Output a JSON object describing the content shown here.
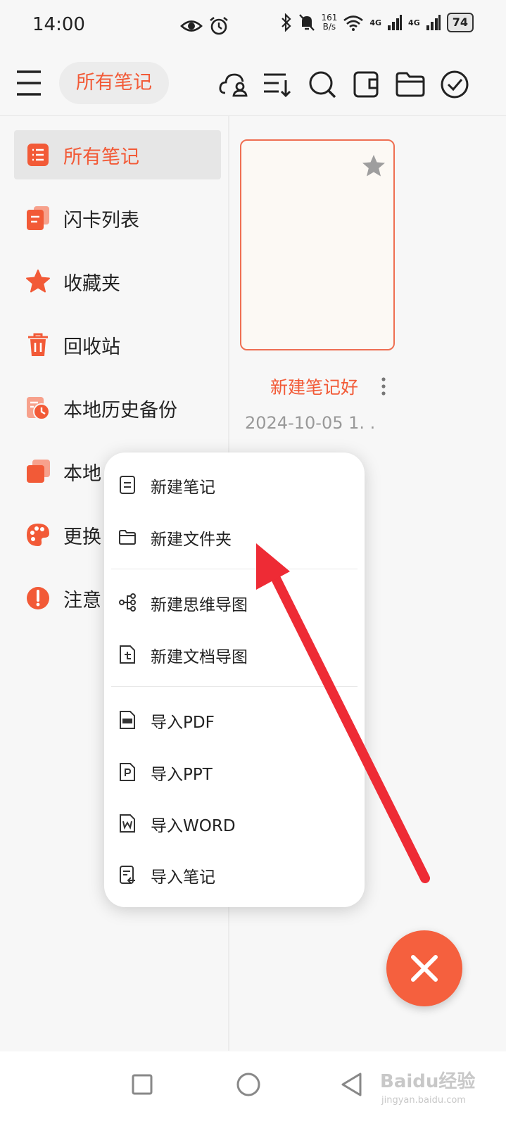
{
  "status_bar": {
    "time": "14:00",
    "net_speed_value": "161",
    "net_speed_unit": "B/s",
    "signal_1": "4G",
    "signal_2": "4G",
    "battery": "74",
    "icons": [
      "eye-icon",
      "alarm-icon",
      "bluetooth-icon",
      "mute-bell-icon",
      "wifi-icon",
      "signal-icon",
      "battery-icon"
    ]
  },
  "toolbar": {
    "title": "所有笔记",
    "icons": [
      "menu-icon",
      "cloud-user-icon",
      "sort-icon",
      "search-icon",
      "wallet-icon",
      "folder-icon",
      "check-circle-icon"
    ]
  },
  "sidebar": {
    "items": [
      {
        "label": "所有笔记",
        "icon": "list-icon"
      },
      {
        "label": "闪卡列表",
        "icon": "flashcard-icon"
      },
      {
        "label": "收藏夹",
        "icon": "star-icon"
      },
      {
        "label": "回收站",
        "icon": "trash-icon"
      },
      {
        "label": "本地历史备份",
        "icon": "history-icon"
      },
      {
        "label": "本地",
        "icon": "copy-icon"
      },
      {
        "label": "更换",
        "icon": "palette-icon"
      },
      {
        "label": "注意",
        "icon": "warning-icon"
      }
    ]
  },
  "note": {
    "title": "新建笔记好",
    "date": "2024-10-05 1. ."
  },
  "popup_menu": {
    "items": [
      {
        "label": "新建笔记",
        "icon": "note-icon"
      },
      {
        "label": "新建文件夹",
        "icon": "folder-icon"
      },
      {
        "label": "新建思维导图",
        "icon": "mindmap-icon"
      },
      {
        "label": "新建文档导图",
        "icon": "doc-map-icon"
      },
      {
        "label": "导入PDF",
        "icon": "pdf-file-icon"
      },
      {
        "label": "导入PPT",
        "icon": "ppt-file-icon"
      },
      {
        "label": "导入WORD",
        "icon": "word-file-icon"
      },
      {
        "label": "导入笔记",
        "icon": "import-note-icon"
      }
    ]
  },
  "colors": {
    "accent": "#f25a37",
    "fab": "#f5603e",
    "arrow": "#ee2b35"
  },
  "watermark": {
    "brand": "Baidu经验",
    "sub": "jingyan.baidu.com"
  }
}
